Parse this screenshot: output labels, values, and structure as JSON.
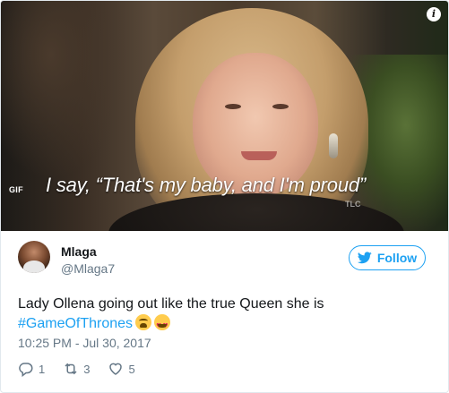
{
  "media": {
    "gif_label": "GIF",
    "caption": "I say, “That's my baby, and I'm proud”",
    "watermark": "TLC",
    "info_icon": "info-icon"
  },
  "user": {
    "name": "Mlaga",
    "handle": "@Mlaga7"
  },
  "follow_button": {
    "label": "Follow",
    "icon": "twitter-bird-icon"
  },
  "tweet": {
    "text": "Lady Ollena going out like the true Queen she is",
    "hashtag": "#GameOfThrones",
    "emojis": [
      "crying-face-emoji",
      "heart-eyes-emoji"
    ]
  },
  "timestamp": "10:25 PM - Jul 30, 2017",
  "actions": {
    "reply_count": "1",
    "retweet_count": "3",
    "like_count": "5"
  },
  "colors": {
    "accent": "#1da1f2",
    "muted": "#657786",
    "text": "#14171a",
    "border": "#e1e8ed"
  }
}
